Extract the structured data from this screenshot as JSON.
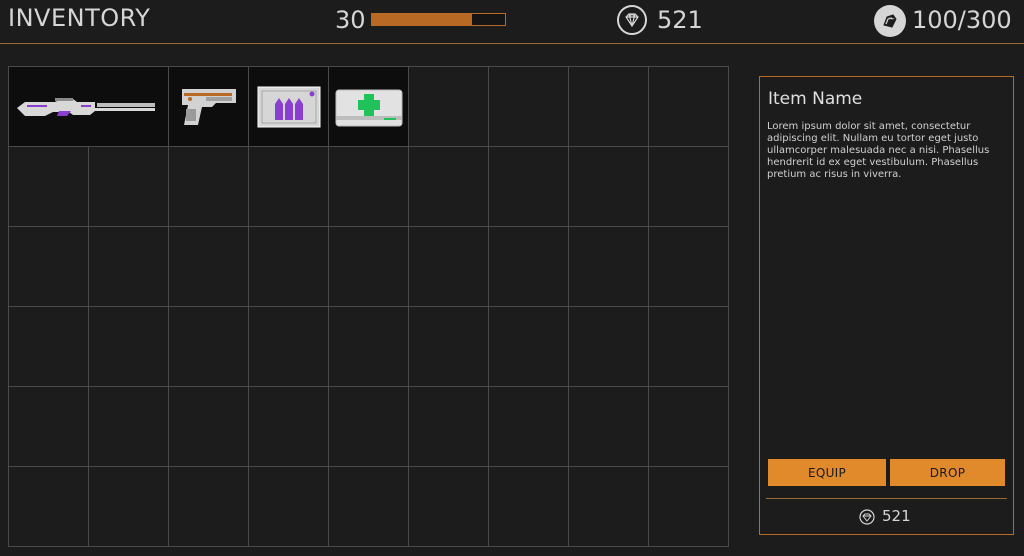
{
  "header": {
    "title": "INVENTORY",
    "level": "30",
    "xp_progress": 0.75,
    "gems": "521",
    "weight": "100/300"
  },
  "grid": {
    "columns": 9,
    "rows": 6
  },
  "items": [
    {
      "name": "sniper-rifle",
      "slot_cols": 2
    },
    {
      "name": "pistol",
      "slot_cols": 1
    },
    {
      "name": "ammo-box",
      "slot_cols": 1
    },
    {
      "name": "medkit",
      "slot_cols": 1
    }
  ],
  "detail": {
    "item_name": "Item Name",
    "description": "Lorem ipsum dolor sit amet, consectetur adipiscing elit. Nullam eu tortor eget justo ullamcorper malesuada nec a nisi. Phasellus hendrerit id ex eget vestibulum. Phasellus pretium ac risus in viverra.",
    "equip_label": "EQUIP",
    "drop_label": "DROP",
    "value": "521"
  },
  "colors": {
    "accent": "#e08a2c",
    "border_accent": "#b86a24",
    "background": "#1c1c1c",
    "grid_line": "#4a4a4a"
  }
}
